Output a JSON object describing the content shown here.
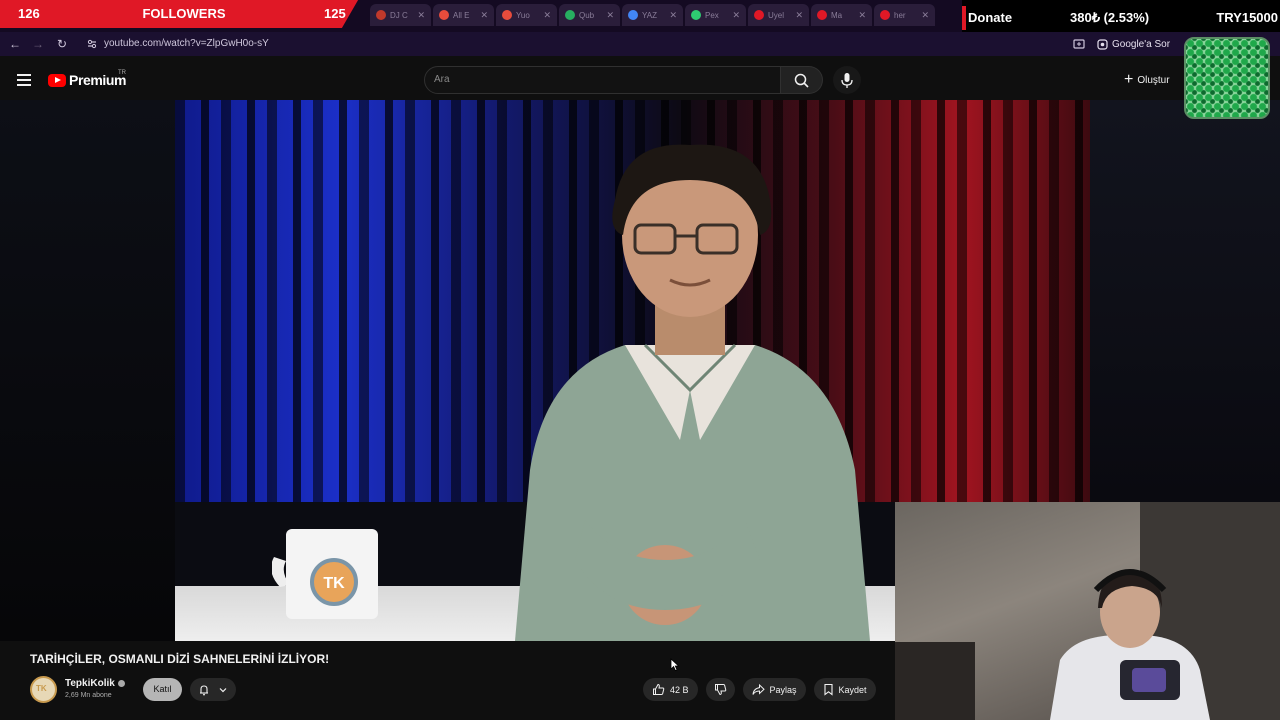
{
  "overlay": {
    "followers_left": "126",
    "followers_label": "FOLLOWERS",
    "followers_right": "125",
    "donate_label": "Donate",
    "donate_goal": "380₺ (2.53%)",
    "donate_total": "TRY15000",
    "accent_color": "#e01826"
  },
  "tabs": [
    {
      "title": "DJ C",
      "icon": "tab-favicon",
      "color": "#c0392b"
    },
    {
      "title": "All E",
      "icon": "tab-favicon",
      "color": "#e74c3c"
    },
    {
      "title": "Yuo",
      "icon": "tab-favicon",
      "color": "#e74c3c"
    },
    {
      "title": "Qub",
      "icon": "tab-favicon",
      "color": "#27ae60"
    },
    {
      "title": "YAZ",
      "icon": "google-icon",
      "color": "#4285f4"
    },
    {
      "title": "Pex",
      "icon": "tab-favicon",
      "color": "#2ecc71"
    },
    {
      "title": "Uyel",
      "icon": "tab-favicon",
      "color": "#e01826"
    },
    {
      "title": "Ma",
      "icon": "tab-favicon",
      "color": "#e01826"
    },
    {
      "title": "her",
      "icon": "tab-favicon",
      "color": "#e01826"
    }
  ],
  "browser": {
    "url": "youtube.com/watch?v=ZlpGwH0o-sY",
    "google_ask": "Google'a Sor"
  },
  "youtube": {
    "logo_text": "Premium",
    "country": "TR",
    "search_placeholder": "Ara",
    "create_label": "Oluştur"
  },
  "video": {
    "title": "TARİHÇİLER, OSMANLI DİZİ SAHNELERİNİ İZLİYOR!",
    "channel_name": "TepkiKolik",
    "channel_initials": "TK",
    "subscribers": "2,69 Mn abone",
    "join_label": "Katıl",
    "likes": "42 B",
    "share_label": "Paylaş",
    "save_label": "Kaydet"
  }
}
